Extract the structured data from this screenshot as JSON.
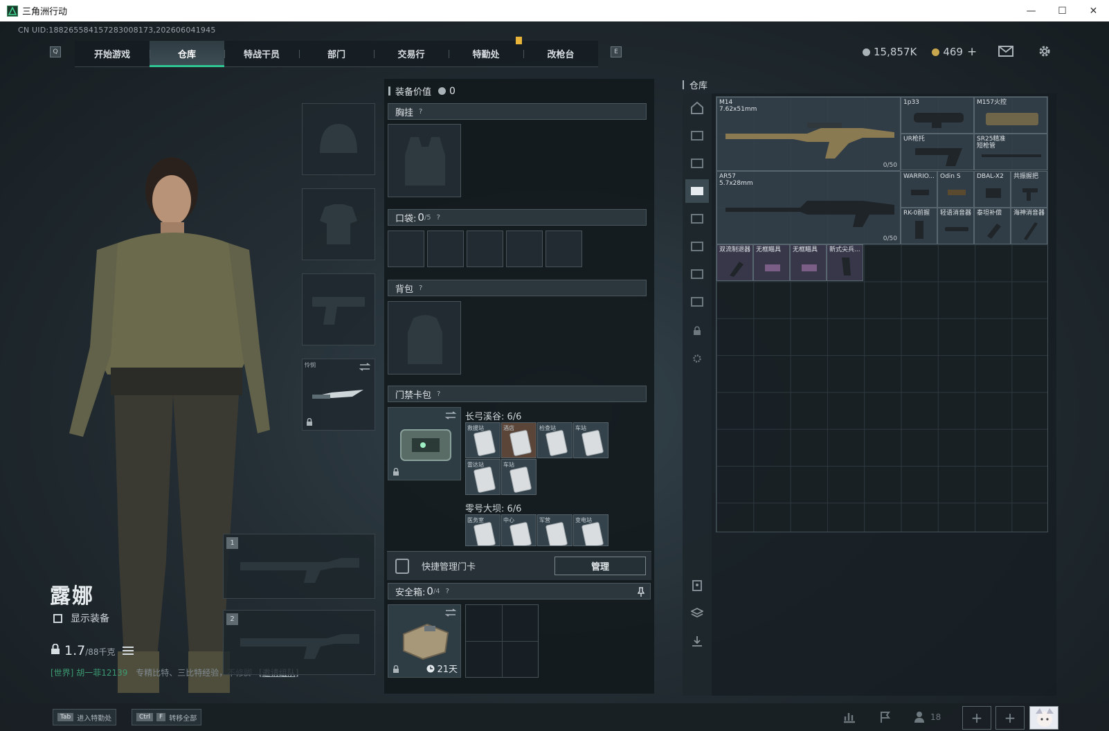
{
  "window": {
    "title": "三角洲行动",
    "minimize": "—",
    "maximize": "☐",
    "close": "✕"
  },
  "uid": "CN UID:1882655841572830081​73,202606041945",
  "nav": {
    "left_key": "Q",
    "right_key": "E",
    "tabs": [
      "开始游戏",
      "仓库",
      "特战干员",
      "部门",
      "交易行",
      "特勤处",
      "改枪台"
    ],
    "active": "仓库"
  },
  "currency": {
    "silver": "15,857K",
    "gold": "469",
    "gold_add": "+"
  },
  "character": {
    "name": "露娜",
    "show_equipment_label": "显示装备",
    "weight": "1.7",
    "weight_max": "/88千克"
  },
  "melee": {
    "label": "怜悯"
  },
  "weapon_slots": [
    "1",
    "2"
  ],
  "chat": {
    "channel": "[世界]",
    "name": "胡一菲12139",
    "message": "专精比特、三比特经验，不修脚",
    "invite": "[邀请组队]"
  },
  "equipment": {
    "header": "装备价值",
    "value": "0",
    "chest_rig": "胸挂",
    "pocket": "口袋:",
    "pocket_count": "0",
    "pocket_max": "/5",
    "backpack": "背包",
    "keycard_bag": "门禁卡包",
    "help": "?",
    "keycards": {
      "group1_title": "长弓溪谷: 6/6",
      "group1": [
        "救援站",
        "酒店",
        "检查站",
        "车站",
        "雷达站",
        "车站"
      ],
      "group2_title": "零号大坝: 6/6",
      "group2": [
        "医务室",
        "中心",
        "军营",
        "变电站"
      ]
    },
    "quick_manage": "快捷管理门卡",
    "manage_btn": "管理",
    "safe_box": "安全箱:",
    "safe_count": "0",
    "safe_max": "/4",
    "safe_days": "21天"
  },
  "storage": {
    "label": "仓库",
    "items": [
      {
        "name": "M14",
        "sub": "7.62x51mm",
        "cap": "0/50"
      },
      {
        "name": "1p33"
      },
      {
        "name": "M157火控"
      },
      {
        "name": "UR枪托"
      },
      {
        "name": "SR25精准",
        "sub": "短枪管"
      },
      {
        "name": "AR57",
        "sub": "5.7x28mm",
        "cap": "0/50"
      },
      {
        "name": "WARRIO..."
      },
      {
        "name": "Odin S"
      },
      {
        "name": "DBAL-X2"
      },
      {
        "name": "共振握把"
      },
      {
        "name": "RK-0前握"
      },
      {
        "name": "轻语消音器"
      },
      {
        "name": "泰坦补偿"
      },
      {
        "name": "海神消音器"
      },
      {
        "name": "双流制退器"
      },
      {
        "name": "无框瞄具"
      },
      {
        "name": "无框瞄具"
      },
      {
        "name": "新式尖兵..."
      }
    ]
  },
  "bottom": {
    "tab_key": "Tab",
    "tab_label": "进入特勤处",
    "ctrl_key": "Ctrl",
    "f_key": "F",
    "transfer_label": "转移全部",
    "friends": "18",
    "plus": "+"
  },
  "colors": {
    "accent": "#2fc593",
    "gold": "#c9a74f",
    "notice": "#e8b43a"
  }
}
